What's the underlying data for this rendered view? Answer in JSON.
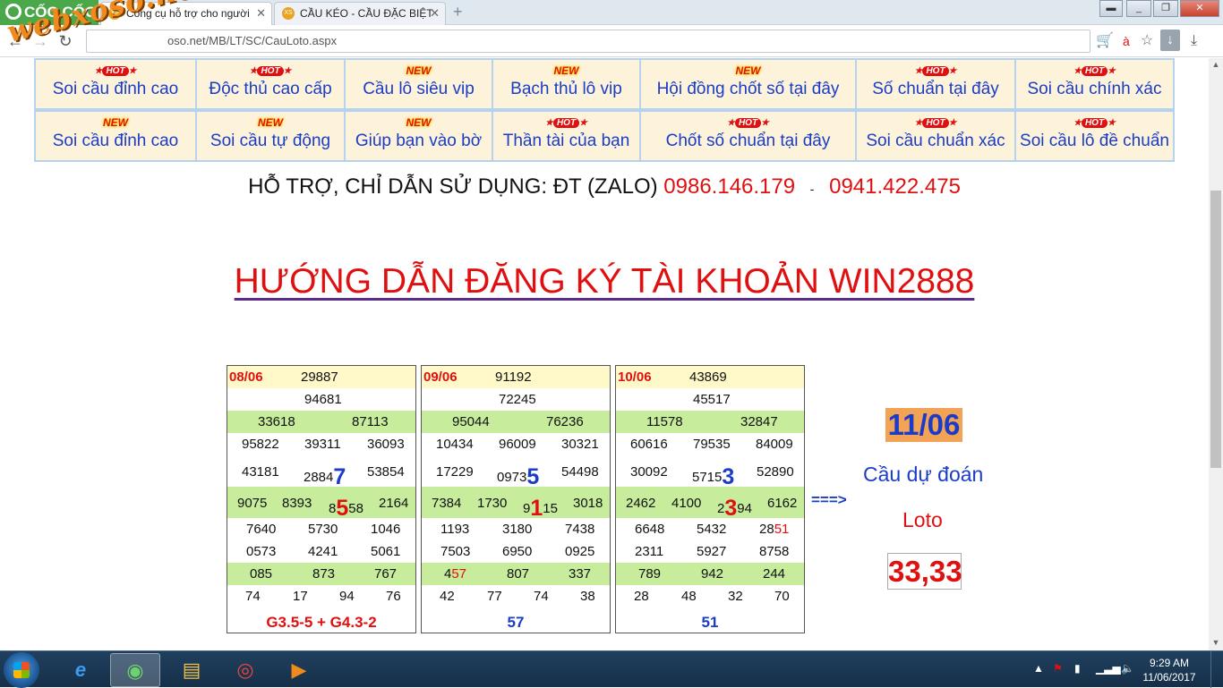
{
  "browser": {
    "brand": "CỐC CỐC",
    "tabs": [
      {
        "label": "Công cụ hỗ trợ cho người",
        "favicon": "XS"
      },
      {
        "label": "CẦU KÉO - CẦU ĐẶC BIỆT",
        "favicon": "XS"
      }
    ],
    "url": "oso.net/MB/LT/SC/CauLoto.aspx",
    "watermark": "webxoso.net"
  },
  "menu_row1": [
    {
      "badge": "HOT",
      "label": "Soi cầu đỉnh cao"
    },
    {
      "badge": "HOT",
      "label": "Độc thủ cao cấp"
    },
    {
      "badge": "NEW",
      "label": "Cầu lô siêu vip"
    },
    {
      "badge": "NEW",
      "label": "Bạch thủ lô vip"
    },
    {
      "badge": "NEW",
      "label": "Hội đồng chốt số tại đây"
    },
    {
      "badge": "HOT",
      "label": "Số chuẩn tại đây"
    },
    {
      "badge": "HOT",
      "label": "Soi cầu chính xác"
    }
  ],
  "menu_row2": [
    {
      "badge": "NEW",
      "label": "Soi cầu đỉnh cao"
    },
    {
      "badge": "NEW",
      "label": "Soi cầu tự động"
    },
    {
      "badge": "NEW",
      "label": "Giúp bạn vào bờ"
    },
    {
      "badge": "HOT",
      "label": "Thần tài của bạn"
    },
    {
      "badge": "HOT",
      "label": "Chốt số chuẩn tại đây"
    },
    {
      "badge": "HOT",
      "label": "Soi cầu chuẩn xác"
    },
    {
      "badge": "HOT",
      "label": "Soi cầu lô đề chuẩn"
    }
  ],
  "support": {
    "text": "HỖ TRỢ, CHỈ DẪN SỬ DỤNG: ĐT (ZALO)",
    "phone1": "0986.146.179",
    "separator": "-",
    "phone2": "0941.422.475"
  },
  "headline": "HƯỚNG DẪN ĐĂNG KÝ TÀI KHOẢN WIN2888",
  "results": [
    {
      "date": "08/06",
      "special": "29887",
      "g1": "94681",
      "g2": [
        "33618",
        "87113"
      ],
      "g3a": [
        "95822",
        "39311",
        "36093"
      ],
      "g3b": [
        "43181",
        "2884",
        "7",
        "53854"
      ],
      "g4": [
        "9075",
        "8393",
        "8",
        "5",
        "58",
        "2164"
      ],
      "g5a": [
        "7640",
        "5730",
        "1046"
      ],
      "g5b": [
        "0573",
        "4241",
        "5061"
      ],
      "g6": [
        "085",
        "873",
        "767"
      ],
      "g7": [
        "74",
        "17",
        "94",
        "76"
      ],
      "footer": "G3.5-5 + G4.3-2"
    },
    {
      "date": "09/06",
      "special": "91192",
      "g1": "72245",
      "g2": [
        "95044",
        "76236"
      ],
      "g3a": [
        "10434",
        "96009",
        "30321"
      ],
      "g3b": [
        "17229",
        "0973",
        "5",
        "54498"
      ],
      "g4": [
        "7384",
        "1730",
        "9",
        "1",
        "15",
        "3018"
      ],
      "g5a": [
        "1193",
        "3180",
        "7438"
      ],
      "g5b": [
        "7503",
        "6950",
        "0925"
      ],
      "g6": [
        "4",
        "57",
        "807",
        "337"
      ],
      "g7": [
        "42",
        "77",
        "74",
        "38"
      ],
      "footer": "57"
    },
    {
      "date": "10/06",
      "special": "43869",
      "g1": "45517",
      "g2": [
        "11578",
        "32847"
      ],
      "g3a": [
        "60616",
        "79535",
        "84009"
      ],
      "g3b": [
        "30092",
        "5715",
        "3",
        "52890"
      ],
      "g4": [
        "2462",
        "4100",
        "2",
        "3",
        "94",
        "6162"
      ],
      "g5a": [
        "6648",
        "5432",
        "28",
        "51"
      ],
      "g5b": [
        "2311",
        "5927",
        "8758"
      ],
      "g6": [
        "789",
        "942",
        "244"
      ],
      "g7": [
        "28",
        "48",
        "32",
        "70"
      ],
      "footer": "51"
    }
  ],
  "prediction": {
    "arrow": "===>",
    "date": "11/06",
    "title": "Cầu dự đoán",
    "type": "Loto",
    "value": "33,33"
  },
  "taskbar": {
    "time": "9:29 AM",
    "date": "11/06/2017"
  },
  "colors": {
    "accent_red": "#e01010",
    "accent_blue": "#1a3cc8",
    "menu_bg": "#fdf3da",
    "green_row": "#c6ec9c",
    "yellow_row": "#fff8c8"
  }
}
